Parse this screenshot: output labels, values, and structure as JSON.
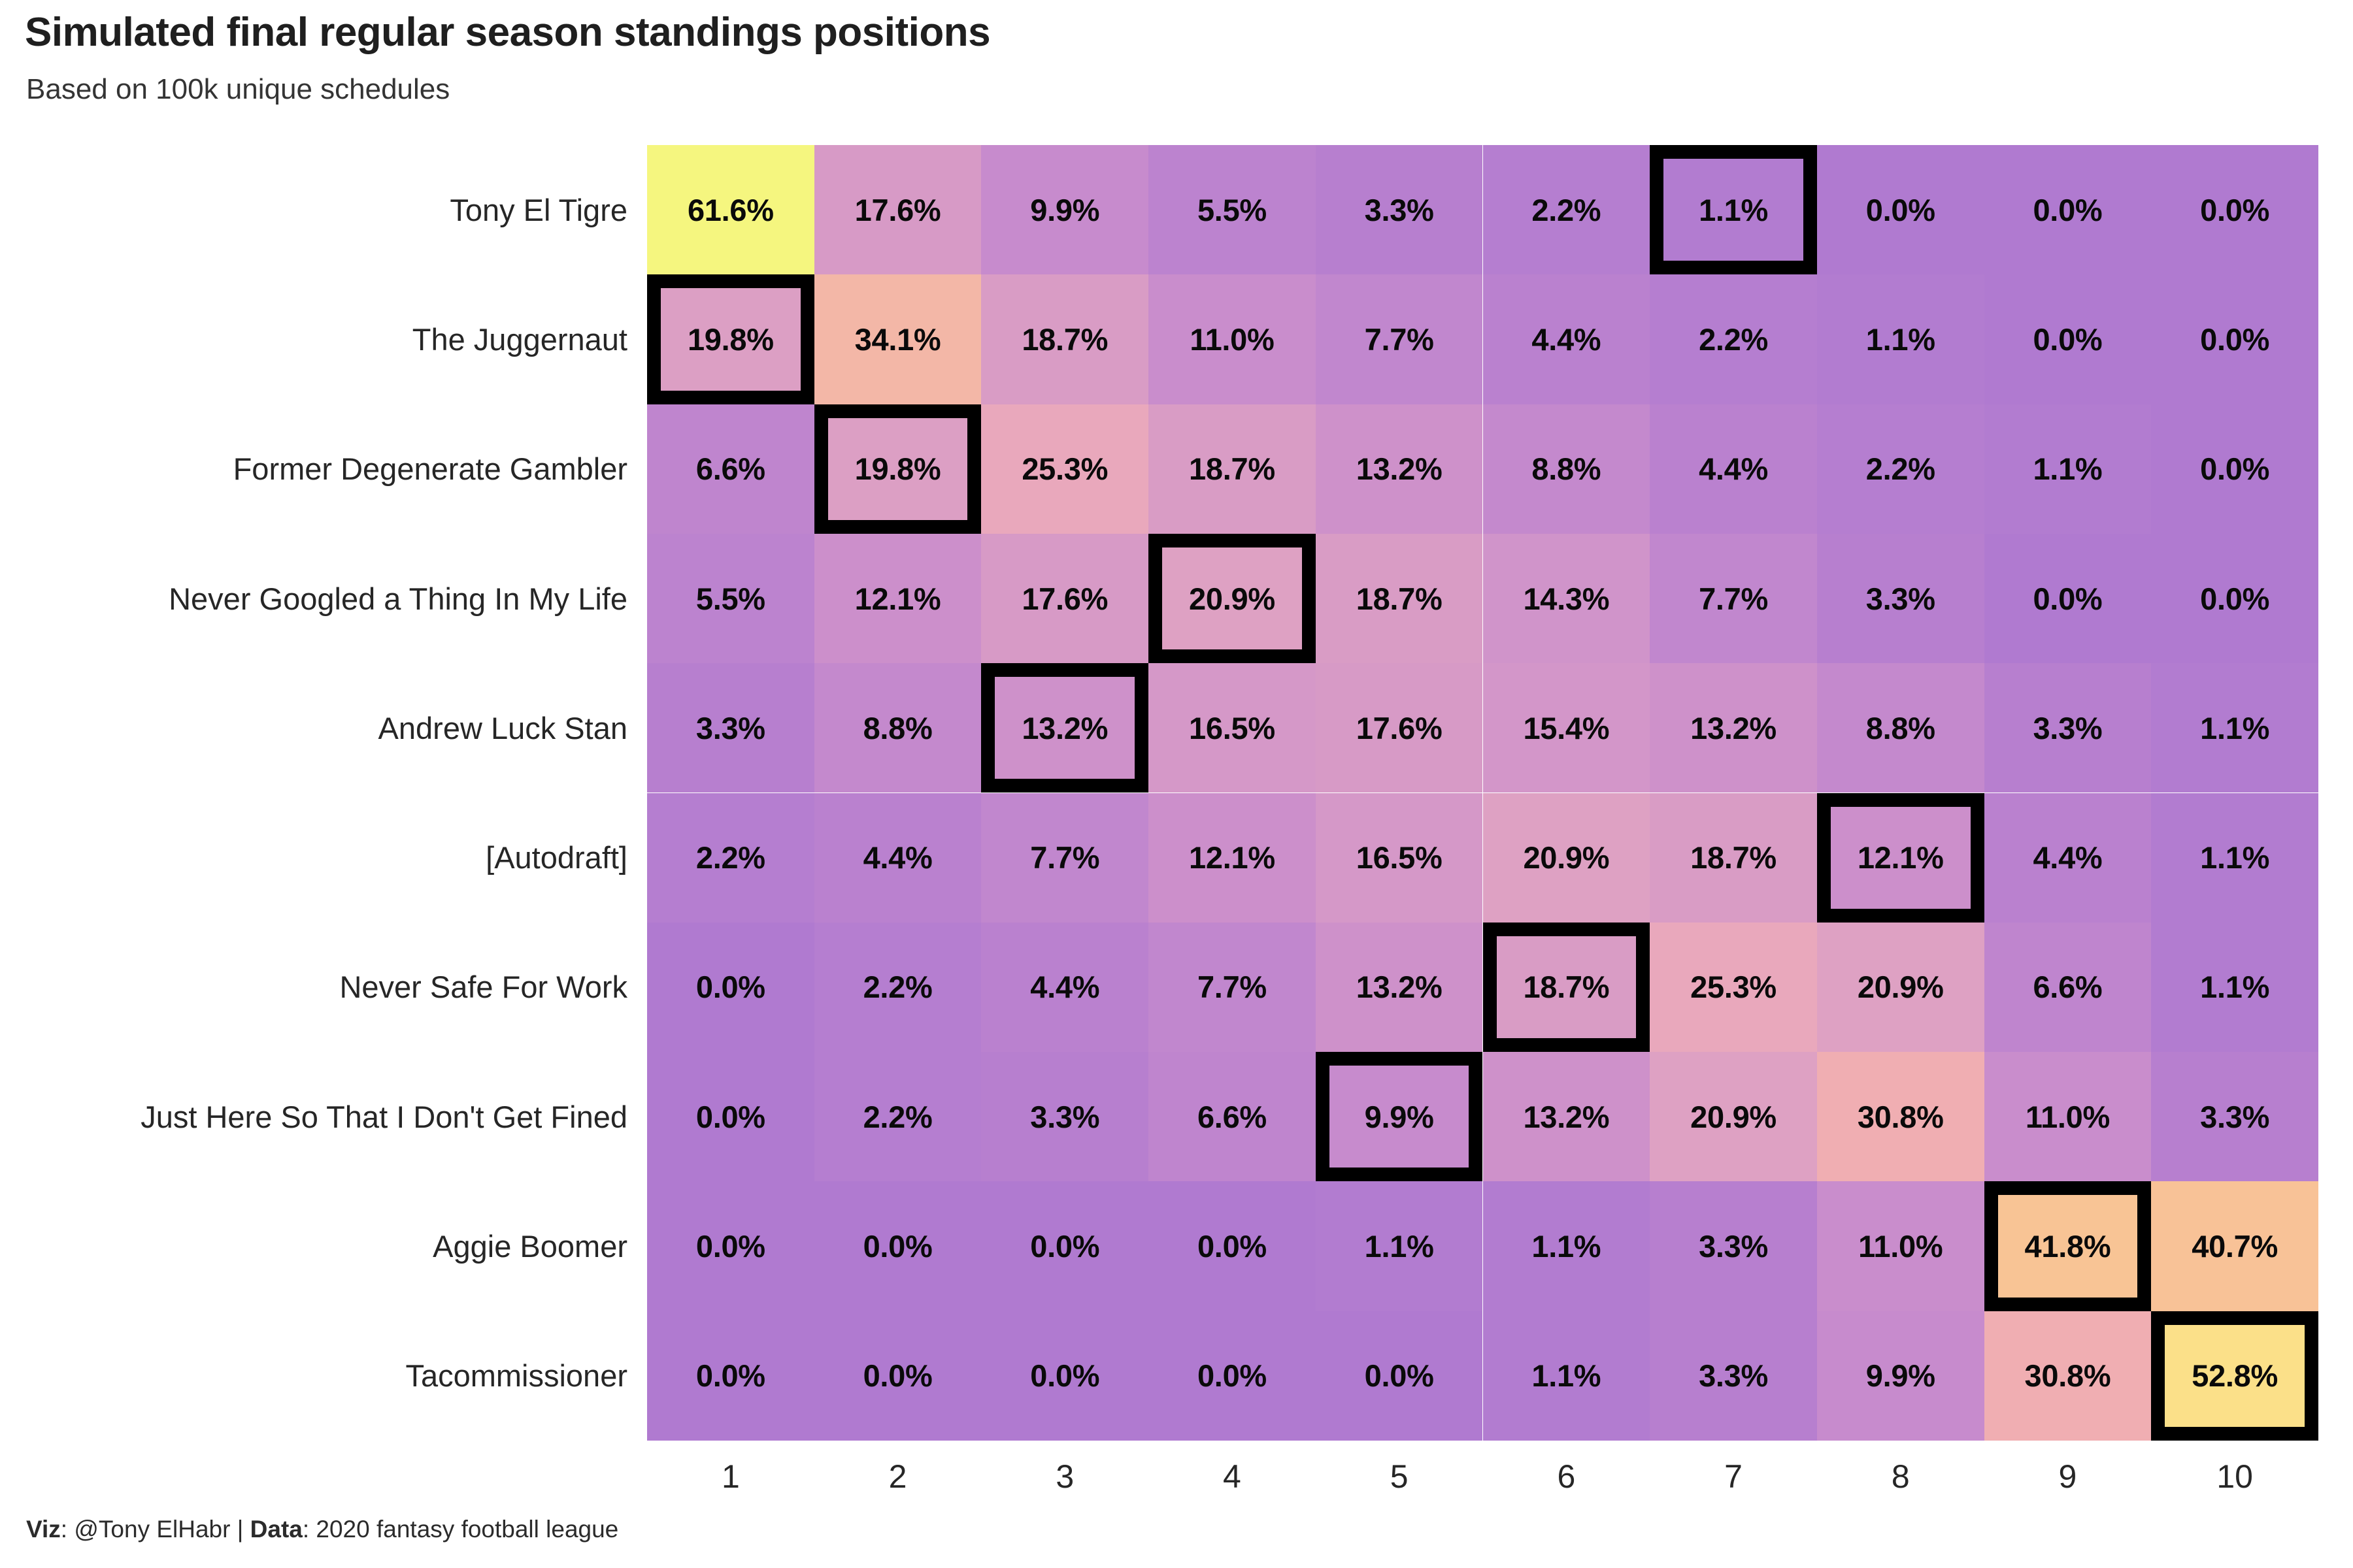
{
  "header": {
    "title": "Simulated final regular season standings positions",
    "subtitle": "Based on 100k unique schedules"
  },
  "caption": {
    "viz_label": "Viz",
    "viz_value": ": @Tony ElHabr ",
    "separator": "| ",
    "data_label": "Data",
    "data_value": ": 2020 fantasy football league"
  },
  "chart_data": {
    "type": "heatmap",
    "title": "Simulated final regular season standings positions",
    "subtitle": "Based on 100k unique schedules",
    "xlabel": "",
    "ylabel": "",
    "value_suffix": "%",
    "grid": false,
    "legend": "none",
    "colormap": {
      "name": "plasma-like",
      "stops": [
        {
          "value": 0.0,
          "color": "#b07ad0"
        },
        {
          "value": 5.0,
          "color": "#bb82cf"
        },
        {
          "value": 10.0,
          "color": "#c78bcd"
        },
        {
          "value": 15.0,
          "color": "#d295c9"
        },
        {
          "value": 20.0,
          "color": "#dc9fc4"
        },
        {
          "value": 25.0,
          "color": "#e9a8bd"
        },
        {
          "value": 31.0,
          "color": "#f0aeb2"
        },
        {
          "value": 35.0,
          "color": "#f4b9a4"
        },
        {
          "value": 41.0,
          "color": "#f8c296"
        },
        {
          "value": 48.0,
          "color": "#fad48b"
        },
        {
          "value": 53.0,
          "color": "#fbe089"
        },
        {
          "value": 62.0,
          "color": "#f5f77f"
        }
      ]
    },
    "xlim": [
      1,
      10
    ],
    "columns": [
      "1",
      "2",
      "3",
      "4",
      "5",
      "6",
      "7",
      "8",
      "9",
      "10"
    ],
    "rows": [
      "Tony El Tigre",
      "The Juggernaut",
      "Former Degenerate Gambler",
      "Never Googled a Thing In My Life",
      "Andrew Luck Stan",
      "[Autodraft]",
      "Never Safe For Work",
      "Just Here So That I Don't Get Fined",
      "Aggie Boomer",
      "Tacommissioner"
    ],
    "values": [
      [
        61.6,
        17.6,
        9.9,
        5.5,
        3.3,
        2.2,
        1.1,
        0.0,
        0.0,
        0.0
      ],
      [
        19.8,
        34.1,
        18.7,
        11.0,
        7.7,
        4.4,
        2.2,
        1.1,
        0.0,
        0.0
      ],
      [
        6.6,
        19.8,
        25.3,
        18.7,
        13.2,
        8.8,
        4.4,
        2.2,
        1.1,
        0.0
      ],
      [
        5.5,
        12.1,
        17.6,
        20.9,
        18.7,
        14.3,
        7.7,
        3.3,
        0.0,
        0.0
      ],
      [
        3.3,
        8.8,
        13.2,
        16.5,
        17.6,
        15.4,
        13.2,
        8.8,
        3.3,
        1.1
      ],
      [
        2.2,
        4.4,
        7.7,
        12.1,
        16.5,
        20.9,
        18.7,
        12.1,
        4.4,
        1.1
      ],
      [
        0.0,
        2.2,
        4.4,
        7.7,
        13.2,
        18.7,
        25.3,
        20.9,
        6.6,
        1.1
      ],
      [
        0.0,
        2.2,
        3.3,
        6.6,
        9.9,
        13.2,
        20.9,
        30.8,
        11.0,
        3.3
      ],
      [
        0.0,
        0.0,
        0.0,
        0.0,
        1.1,
        1.1,
        3.3,
        11.0,
        41.8,
        40.7
      ],
      [
        0.0,
        0.0,
        0.0,
        0.0,
        0.0,
        1.1,
        3.3,
        9.9,
        30.8,
        52.8
      ]
    ],
    "labels": [
      [
        "61.6%",
        "17.6%",
        "9.9%",
        "5.5%",
        "3.3%",
        "2.2%",
        "1.1%",
        "0.0%",
        "0.0%",
        "0.0%"
      ],
      [
        "19.8%",
        "34.1%",
        "18.7%",
        "11.0%",
        "7.7%",
        "4.4%",
        "2.2%",
        "1.1%",
        "0.0%",
        "0.0%"
      ],
      [
        "6.6%",
        "19.8%",
        "25.3%",
        "18.7%",
        "13.2%",
        "8.8%",
        "4.4%",
        "2.2%",
        "1.1%",
        "0.0%"
      ],
      [
        "5.5%",
        "12.1%",
        "17.6%",
        "20.9%",
        "18.7%",
        "14.3%",
        "7.7%",
        "3.3%",
        "0.0%",
        "0.0%"
      ],
      [
        "3.3%",
        "8.8%",
        "13.2%",
        "16.5%",
        "17.6%",
        "15.4%",
        "13.2%",
        "8.8%",
        "3.3%",
        "1.1%"
      ],
      [
        "2.2%",
        "4.4%",
        "7.7%",
        "12.1%",
        "16.5%",
        "20.9%",
        "18.7%",
        "12.1%",
        "4.4%",
        "1.1%"
      ],
      [
        "0.0%",
        "2.2%",
        "4.4%",
        "7.7%",
        "13.2%",
        "18.7%",
        "25.3%",
        "20.9%",
        "6.6%",
        "1.1%"
      ],
      [
        "0.0%",
        "2.2%",
        "3.3%",
        "6.6%",
        "9.9%",
        "13.2%",
        "20.9%",
        "30.8%",
        "11.0%",
        "3.3%"
      ],
      [
        "0.0%",
        "0.0%",
        "0.0%",
        "0.0%",
        "1.1%",
        "1.1%",
        "3.3%",
        "11.0%",
        "41.8%",
        "40.7%"
      ],
      [
        "0.0%",
        "0.0%",
        "0.0%",
        "0.0%",
        "0.0%",
        "1.1%",
        "3.3%",
        "9.9%",
        "30.8%",
        "52.8%"
      ]
    ],
    "highlighted_cells": [
      {
        "row": 0,
        "col": 6
      },
      {
        "row": 1,
        "col": 0
      },
      {
        "row": 2,
        "col": 1
      },
      {
        "row": 3,
        "col": 3
      },
      {
        "row": 4,
        "col": 2
      },
      {
        "row": 5,
        "col": 7
      },
      {
        "row": 6,
        "col": 5
      },
      {
        "row": 7,
        "col": 4
      },
      {
        "row": 8,
        "col": 8
      },
      {
        "row": 9,
        "col": 9
      }
    ],
    "highlight_color": "#000000"
  }
}
